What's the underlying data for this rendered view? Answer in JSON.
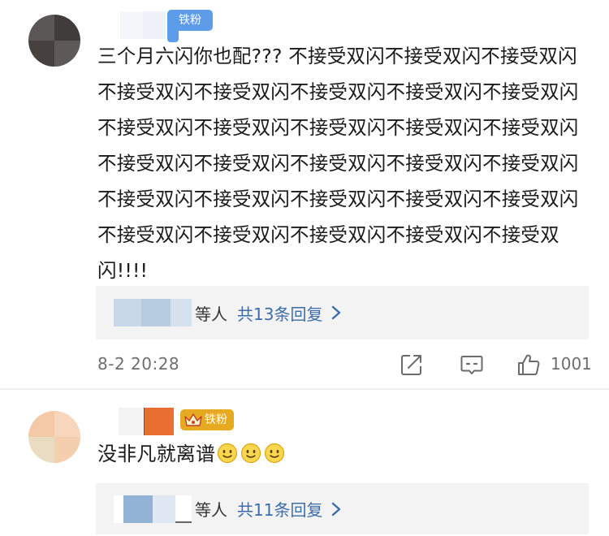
{
  "comments": [
    {
      "fan_badge": "铁粉",
      "text": "三个月六闪你也配??? 不接受双闪不接受双闪不接受双闪不接受双闪不接受双闪不接受双闪不接受双闪不接受双闪不接受双闪不接受双闪不接受双闪不接受双闪不接受双闪不接受双闪不接受双闪不接受双闪不接受双闪不接受双闪不接受双闪不接受双闪不接受双闪不接受双闪不接受双闪不接受双闪不接受双闪不接受双闪不接受双闪不接受双闪!!!!",
      "replies": {
        "people_suffix": "等人",
        "count_label": "共13条回复"
      },
      "timestamp": "8-2 20:28",
      "like_count": "1001"
    },
    {
      "fan_badge": "铁粉",
      "text": "没非凡就离谱",
      "emoji_names": [
        "smile-emoji",
        "smile-emoji",
        "smile-emoji"
      ],
      "replies": {
        "people_suffix": "等人",
        "count_label": "共11条回复"
      }
    }
  ],
  "colors": {
    "link_blue": "#3d6da8",
    "fan_badge_blue": "#5d9ce8",
    "fan_badge_gold": "#e5aa1f",
    "reply_box_bg": "#f3f3f3",
    "meta_gray": "#6e6e6e"
  },
  "icons": [
    "chevron-right-icon",
    "share-icon",
    "comment-icon",
    "like-icon",
    "crown-icon",
    "smile-emoji"
  ]
}
